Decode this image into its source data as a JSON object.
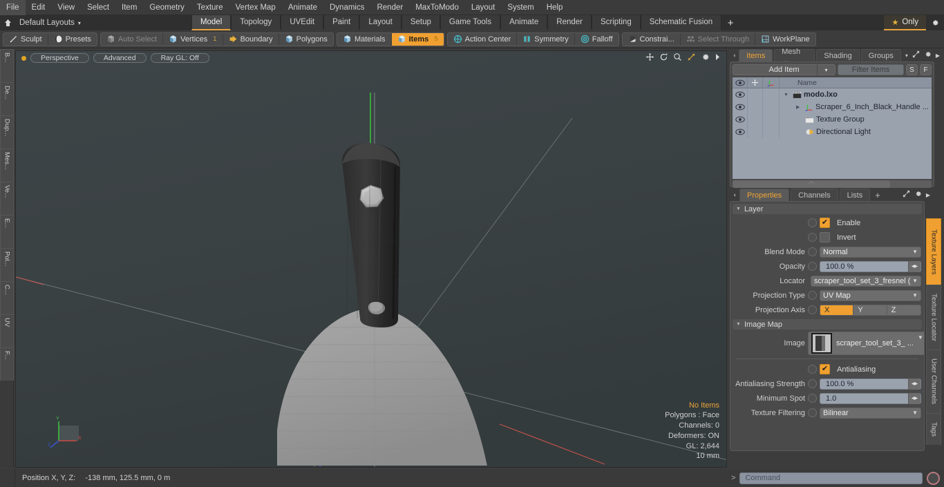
{
  "app": {
    "title": "modo",
    "accent": "#f0a030",
    "menu_items": [
      "File",
      "Edit",
      "View",
      "Select",
      "Item",
      "Geometry",
      "Texture",
      "Vertex Map",
      "Animate",
      "Dynamics",
      "Render",
      "MaxToModo",
      "Layout",
      "System",
      "Help"
    ]
  },
  "layoutbar": {
    "home_icon": "home-icon",
    "layouts_label": "Default Layouts",
    "caret": "▾",
    "tabs": [
      {
        "label": "Model",
        "active": true
      },
      {
        "label": "Topology",
        "active": false
      },
      {
        "label": "UVEdit",
        "active": false
      },
      {
        "label": "Paint",
        "active": false
      },
      {
        "label": "Layout",
        "active": false
      },
      {
        "label": "Setup",
        "active": false
      },
      {
        "label": "Game Tools",
        "active": false
      },
      {
        "label": "Animate",
        "active": false
      },
      {
        "label": "Render",
        "active": false
      },
      {
        "label": "Scripting",
        "active": false
      },
      {
        "label": "Schematic Fusion",
        "active": false
      }
    ],
    "add_tab_label": "+",
    "only_label": "Only",
    "star_glyph": "★",
    "gear_glyph": "✥"
  },
  "modebar": {
    "group1": [
      {
        "label": "Sculpt",
        "icon": "pencil-icon",
        "state": "normal"
      },
      {
        "label": "Presets",
        "icon": "sphere-icon",
        "state": "normal"
      }
    ],
    "group2": [
      {
        "label": "Auto Select",
        "icon": "cube-gray-icon",
        "state": "dim",
        "count": ""
      },
      {
        "label": "Vertices",
        "icon": "cube-blue-icon",
        "state": "normal",
        "count": "1"
      },
      {
        "label": "Boundary",
        "icon": "boundary-icon",
        "state": "normal",
        "count": ""
      },
      {
        "label": "Polygons",
        "icon": "cube-blue-icon",
        "state": "normal",
        "count": ""
      }
    ],
    "group3": [
      {
        "label": "Materials",
        "icon": "cube-blue-icon",
        "state": "normal",
        "count": ""
      },
      {
        "label": "Items",
        "icon": "cube-orange-icon",
        "state": "active",
        "count": "5"
      }
    ],
    "group4": [
      {
        "label": "Action Center",
        "icon": "crosshair-icon",
        "state": "normal"
      },
      {
        "label": "Symmetry",
        "icon": "symmetry-icon",
        "state": "normal"
      },
      {
        "label": "Falloff",
        "icon": "target-icon",
        "state": "normal"
      }
    ],
    "group5": [
      {
        "label": "Constrai...",
        "icon": "constraint-icon",
        "state": "normal"
      },
      {
        "label": "Select Through",
        "icon": "select-through-icon",
        "state": "dim"
      },
      {
        "label": "WorkPlane",
        "icon": "workplane-icon",
        "state": "normal"
      }
    ]
  },
  "left_toolbar": {
    "tabs": [
      "B...",
      "De...",
      "Dup...",
      "Mes...",
      "Ve...",
      "E...",
      "Pol...",
      "C...",
      "UV",
      "F..."
    ]
  },
  "viewport": {
    "pills": [
      "Perspective",
      "Advanced",
      "Ray GL: Off"
    ],
    "tool_icons": [
      "move-icon",
      "rotate-icon",
      "zoom-icon",
      "fit-icon",
      "gear-icon",
      "arrow-right-icon"
    ],
    "info": {
      "selection": "No Items",
      "polygons": "Polygons : Face",
      "channels": "Channels: 0",
      "deformers": "Deformers: ON",
      "gl": "GL: 2,644",
      "scale": "10 mm"
    },
    "gizmo_axes": [
      "X",
      "Y",
      "Z"
    ]
  },
  "statusbar": {
    "position_label": "Position X, Y, Z:",
    "position_value": "-138 mm, 125.5 mm, 0 m"
  },
  "items_panel": {
    "tabs": [
      {
        "label": "Items",
        "active": true
      },
      {
        "label": "Mesh ...",
        "active": false
      },
      {
        "label": "Shading",
        "active": false
      },
      {
        "label": "Groups",
        "active": false
      }
    ],
    "tab_caret": "▾",
    "expand_icon": "expand-icon",
    "gear_icon": "gear-icon",
    "arrow_icon": "arrow-right-icon",
    "add_item_label": "Add Item",
    "add_item_caret": "▾",
    "filter_placeholder": "Filter Items",
    "btn_s": "S",
    "btn_f": "F",
    "columns": [
      "eye-icon",
      "move-icon",
      "axis-icon",
      "Name"
    ],
    "rows": [
      {
        "name": "modo.lxo",
        "icon": "scene-clapper-icon",
        "depth": 0,
        "bold": true,
        "twirl": "▼"
      },
      {
        "name": "Scraper_6_Inch_Black_Handle ...",
        "icon": "locator-axis-icon",
        "depth": 1,
        "bold": false,
        "twirl": "▶"
      },
      {
        "name": "Texture Group",
        "icon": "texture-group-icon",
        "depth": 1,
        "bold": false,
        "twirl": ""
      },
      {
        "name": "Directional Light",
        "icon": "light-icon",
        "depth": 1,
        "bold": false,
        "twirl": ""
      }
    ]
  },
  "properties_panel": {
    "tabs": [
      {
        "label": "Properties",
        "active": true
      },
      {
        "label": "Channels",
        "active": false
      },
      {
        "label": "Lists",
        "active": false
      },
      {
        "label": "+",
        "active": false
      }
    ],
    "expand_icon": "expand-icon",
    "gear_icon": "gear-icon",
    "arrow_icon": "arrow-right-icon",
    "sections": [
      {
        "title": "Layer",
        "triangle": "▼",
        "fields": [
          {
            "type": "checkbox",
            "label": "Enable",
            "checked": true
          },
          {
            "type": "checkbox",
            "label": "Invert",
            "checked": false
          },
          {
            "type": "dropdown",
            "label": "Blend Mode",
            "value": "Normal"
          },
          {
            "type": "slider",
            "label": "Opacity",
            "value": "100.0 %"
          },
          {
            "type": "dropdown_nokn",
            "label": "Locator",
            "value": "scraper_tool_set_3_fresnel ( ..."
          },
          {
            "type": "dropdown",
            "label": "Projection Type",
            "value": "UV Map"
          },
          {
            "type": "axis",
            "label": "Projection Axis",
            "options": [
              "X",
              "Y",
              "Z"
            ],
            "selected": "X"
          }
        ]
      },
      {
        "title": "Image Map",
        "triangle": "▼",
        "fields": [
          {
            "type": "image",
            "label": "Image",
            "value": "scraper_tool_set_3_ ..."
          },
          {
            "type": "checkbox",
            "label": "Antialiasing",
            "checked": true
          },
          {
            "type": "slider",
            "label": "Antialiasing Strength",
            "value": "100.0 %"
          },
          {
            "type": "slider",
            "label": "Minimum Spot",
            "value": "1.0"
          },
          {
            "type": "dropdown",
            "label": "Texture Filtering",
            "value": "Bilinear"
          }
        ]
      }
    ],
    "more_button": ">>"
  },
  "right_vtabs": [
    {
      "label": "Texture Layers",
      "active": true
    },
    {
      "label": "Texture Locator",
      "active": false
    },
    {
      "label": "User Channels",
      "active": false
    },
    {
      "label": "Tags",
      "active": false
    }
  ],
  "command_bar": {
    "caret": ">",
    "placeholder": "Command",
    "record_icon": "record-icon"
  }
}
